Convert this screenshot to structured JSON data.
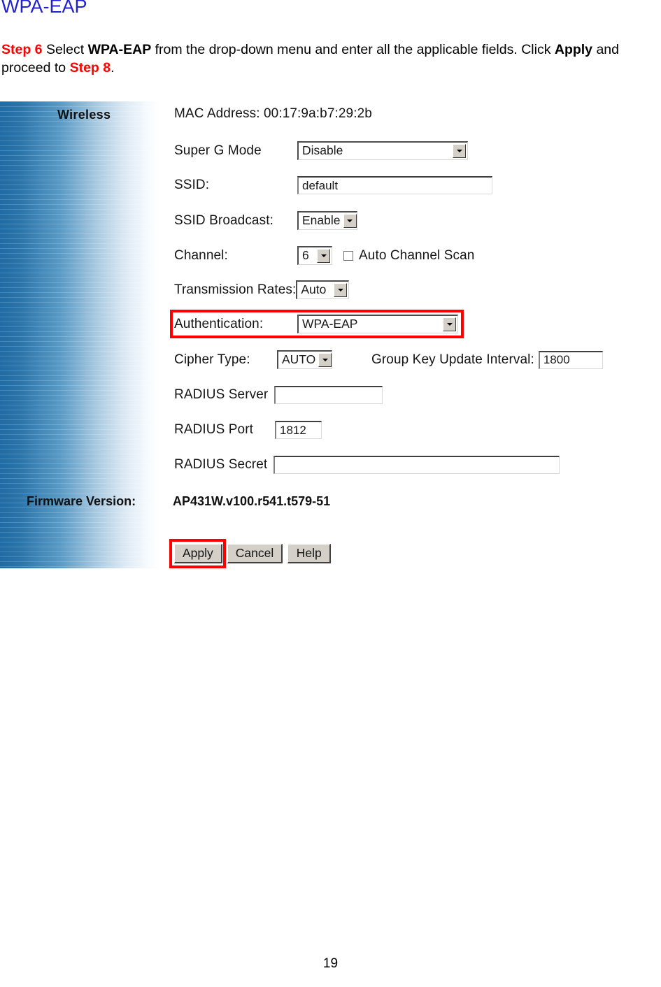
{
  "heading": "WPA-EAP",
  "instructions": {
    "step_label": "Step 6",
    "text_1": " Select ",
    "bold_1": "WPA-EAP",
    "text_2": " from the drop-down menu and enter all the applicable fields. Click ",
    "bold_2": "Apply",
    "text_3": " and proceed to ",
    "step_ref": "Step 8",
    "text_4": "."
  },
  "panel": {
    "sidebar_title": "Wireless",
    "mac_address_line": "MAC Address: 00:17:9a:b7:29:2b",
    "fields": {
      "super_g_mode": {
        "label": "Super G Mode",
        "value": "Disable"
      },
      "ssid": {
        "label": "SSID:",
        "value": "default"
      },
      "ssid_broadcast": {
        "label": "SSID Broadcast:",
        "value": "Enable"
      },
      "channel": {
        "label": "Channel:",
        "value": "6",
        "auto_scan_label": "Auto Channel Scan",
        "auto_scan_checked": false
      },
      "transmission_rates": {
        "label": "Transmission Rates:",
        "value": "Auto"
      },
      "authentication": {
        "label": "Authentication:",
        "value": "WPA-EAP"
      },
      "cipher_type": {
        "label": "Cipher Type:",
        "value": "AUTO"
      },
      "group_key_update_interval": {
        "label": "Group Key Update Interval:",
        "value": "1800"
      },
      "radius_server": {
        "label": "RADIUS Server",
        "value": ""
      },
      "radius_port": {
        "label": "RADIUS Port",
        "value": "1812"
      },
      "radius_secret": {
        "label": "RADIUS Secret",
        "value": ""
      }
    },
    "firmware": {
      "label": "Firmware Version:",
      "value": "AP431W.v100.r541.t579-51"
    },
    "buttons": {
      "apply": "Apply",
      "cancel": "Cancel",
      "help": "Help"
    }
  },
  "highlight_color": "#ff0000",
  "page_number": "19"
}
